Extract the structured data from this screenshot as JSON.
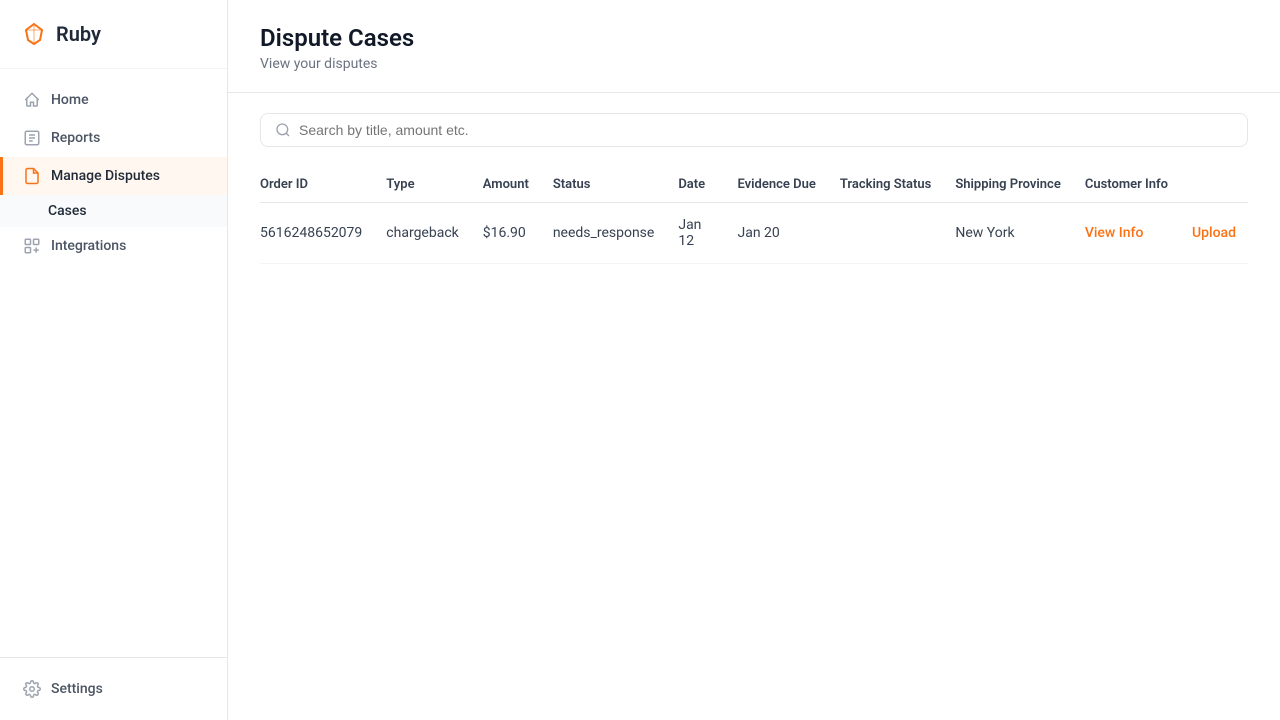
{
  "app": {
    "name": "Ruby"
  },
  "sidebar": {
    "nav_items": [
      {
        "id": "home",
        "label": "Home",
        "icon": "home-icon",
        "active": false
      },
      {
        "id": "reports",
        "label": "Reports",
        "icon": "reports-icon",
        "active": false
      },
      {
        "id": "manage-disputes",
        "label": "Manage Disputes",
        "icon": "disputes-icon",
        "active": true
      },
      {
        "id": "integrations",
        "label": "Integrations",
        "icon": "integrations-icon",
        "active": false
      }
    ],
    "sub_items": [
      {
        "id": "cases",
        "label": "Cases",
        "active": true
      }
    ],
    "bottom_items": [
      {
        "id": "settings",
        "label": "Settings",
        "icon": "settings-icon"
      }
    ]
  },
  "page": {
    "title": "Dispute Cases",
    "subtitle": "View your disputes"
  },
  "search": {
    "placeholder": "Search by title, amount etc."
  },
  "table": {
    "columns": [
      {
        "id": "order_id",
        "label": "Order ID"
      },
      {
        "id": "type",
        "label": "Type"
      },
      {
        "id": "amount",
        "label": "Amount"
      },
      {
        "id": "status",
        "label": "Status"
      },
      {
        "id": "date",
        "label": "Date"
      },
      {
        "id": "evidence_due",
        "label": "Evidence Due"
      },
      {
        "id": "tracking_status",
        "label": "Tracking Status"
      },
      {
        "id": "shipping_province",
        "label": "Shipping Province"
      },
      {
        "id": "customer_info",
        "label": "Customer Info"
      },
      {
        "id": "actions",
        "label": ""
      }
    ],
    "rows": [
      {
        "order_id": "5616248652079",
        "type": "chargeback",
        "amount": "$16.90",
        "status": "needs_response",
        "date": "Jan 12",
        "evidence_due": "Jan 20",
        "tracking_status": "",
        "shipping_province": "New York",
        "customer_info_link": "View Info",
        "action_link": "Upload"
      }
    ]
  }
}
